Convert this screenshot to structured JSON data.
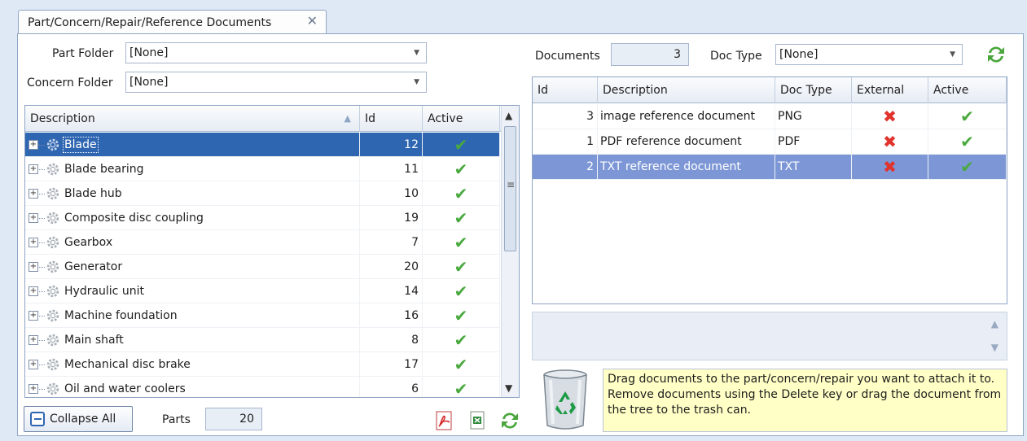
{
  "tab": {
    "title": "Part/Concern/Repair/Reference Documents",
    "close_glyph": "✕"
  },
  "left": {
    "part_folder_label": "Part Folder",
    "part_folder_value": "[None]",
    "concern_folder_label": "Concern Folder",
    "concern_folder_value": "[None]",
    "columns": [
      "Description",
      "Id",
      "Active"
    ],
    "rows": [
      {
        "desc": "Blade",
        "id": "12",
        "active": true,
        "selected": true
      },
      {
        "desc": "Blade bearing",
        "id": "11",
        "active": true
      },
      {
        "desc": "Blade hub",
        "id": "10",
        "active": true
      },
      {
        "desc": "Composite disc coupling",
        "id": "19",
        "active": true
      },
      {
        "desc": "Gearbox",
        "id": "7",
        "active": true
      },
      {
        "desc": "Generator",
        "id": "20",
        "active": true
      },
      {
        "desc": "Hydraulic unit",
        "id": "14",
        "active": true
      },
      {
        "desc": "Machine foundation",
        "id": "16",
        "active": true
      },
      {
        "desc": "Main shaft",
        "id": "8",
        "active": true
      },
      {
        "desc": "Mechanical disc brake",
        "id": "17",
        "active": true
      },
      {
        "desc": "Oil and water coolers",
        "id": "6",
        "active": true
      }
    ],
    "collapse_all_label": "Collapse All",
    "parts_label": "Parts",
    "parts_count": "20"
  },
  "right": {
    "documents_label": "Documents",
    "documents_count": "3",
    "doc_type_label": "Doc Type",
    "doc_type_value": "[None]",
    "columns": [
      "Id",
      "Description",
      "Doc Type",
      "External",
      "Active"
    ],
    "rows": [
      {
        "id": "3",
        "desc": "image reference document",
        "type": "PNG",
        "external": false,
        "active": true
      },
      {
        "id": "1",
        "desc": "PDF reference document",
        "type": "PDF",
        "external": false,
        "active": true
      },
      {
        "id": "2",
        "desc": "TXT reference document",
        "type": "TXT",
        "external": false,
        "active": true,
        "selected": true
      }
    ],
    "info_text": "Drag documents to the part/concern/repair you want to attach it to. Remove documents using the Delete key or drag the document from the tree to the trash can."
  },
  "glyphs": {
    "check": "✔",
    "x": "✖",
    "plus": "+",
    "dropdown": "▼",
    "up": "▲",
    "down": "▼",
    "grip": "≡"
  },
  "colors": {
    "selection": "#2f66b2",
    "selection_inactive": "#7d97d6",
    "check": "#49a93e",
    "x": "#e0342d",
    "info_bg": "#ffffc6"
  }
}
